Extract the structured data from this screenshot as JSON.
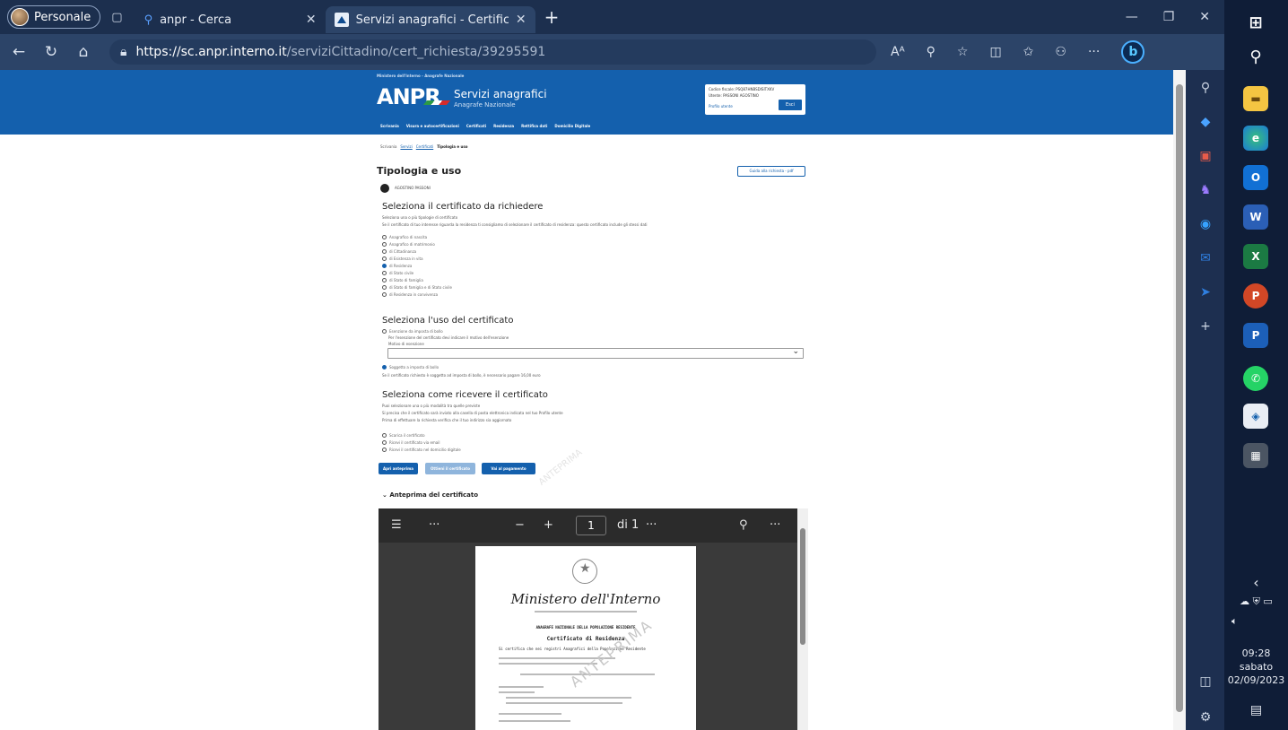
{
  "browser": {
    "profile_label": "Personale",
    "tabs": [
      {
        "title": "anpr - Cerca"
      },
      {
        "title": "Servizi anagrafici - Certificati - "
      }
    ],
    "url_host": "https://sc.anpr.interno.it",
    "url_path": "/serviziCittadino/cert_richiesta/39295591"
  },
  "site": {
    "ministry_line": "Ministero dell'Interno - Anagrafe Nazionale",
    "logo_text": "ANPR",
    "service_title": "Servizi anagrafici",
    "service_subtitle": "Anagrafe Nazionale",
    "user_fiscal_label": "Codice fiscale: PSQ87HNBSDISITXKV",
    "user_name_label": "Utente: PASSONI AGOSTINO",
    "profile_link": "Profilo utente",
    "logout_label": "Esci",
    "nav": [
      "Scrivania",
      "Visura e autocertificazioni",
      "Certificati",
      "Residenza",
      "Rettifica dati",
      "Domicilio Digitale"
    ]
  },
  "breadcrumb": {
    "items": [
      "Scrivania",
      "Servizi",
      "Certificati"
    ],
    "current": "Tipologia e uso"
  },
  "content": {
    "page_title": "Tipologia e uso",
    "guide_button": "Guida alla richiesta - pdf",
    "person_label": "AGOSTINO PASSONI",
    "section1_title": "Seleziona il certificato da richiedere",
    "section1_help_1": "Seleziona una o più tipologie di certificato",
    "section1_help_2": "Se il certificato di tuo interesse riguarda la residenza ti consigliamo di selezionare il certificato di residenza: questo certificato include gli stessi dati",
    "certificates": [
      {
        "label": "Anagrafico di nascita",
        "selected": false
      },
      {
        "label": "Anagrafico di matrimonio",
        "selected": false
      },
      {
        "label": "di Cittadinanza",
        "selected": false
      },
      {
        "label": "di Esistenza in vita",
        "selected": false
      },
      {
        "label": "di Residenza",
        "selected": true
      },
      {
        "label": "di Stato civile",
        "selected": false
      },
      {
        "label": "di Stato di famiglia",
        "selected": false
      },
      {
        "label": "di Stato di famiglia e di Stato civile",
        "selected": false
      },
      {
        "label": "di Residenza in convivenza",
        "selected": false
      }
    ],
    "section2_title": "Seleziona l'uso del certificato",
    "use_options": [
      {
        "label": "Esenzione da imposta di bollo",
        "selected": false
      },
      {
        "label": "Soggetto a imposta di bollo",
        "selected": true
      }
    ],
    "use_help_1": "Per l'esenzione del certificato devi indicare il motivo dell'esenzione",
    "use_help_2": "Motivo di esenzione",
    "use_help_3": "Se il certificato richiesto è soggetto ad imposta di bollo, è necessario pagare 16,00 euro",
    "section3_title": "Seleziona come ricevere il certificato",
    "delivery_help_1": "Puoi selezionare una o più modalità tra quelle previste",
    "delivery_help_2": "Si precisa che il certificato sarà inviato alla casella di posta elettronica indicata nel tuo Profilo utente",
    "delivery_help_3": "Prima di effettuare la richiesta verifica che il tuo indirizzo sia aggiornato",
    "delivery_options": [
      {
        "label": "Scarica il certificato"
      },
      {
        "label": "Ricevi il certificato via email"
      },
      {
        "label": "Ricevi il certificato nel domicilio digitale"
      }
    ],
    "btn_preview": "Apri anteprima",
    "btn_get": "Ottieni il certificato",
    "btn_pay": "Vai al pagamento",
    "preview_toggle": "Anteprima del certificato"
  },
  "pdf_viewer": {
    "page_current": "1",
    "page_total": "di 1",
    "doc_ministry": "Ministero dell'Interno",
    "doc_header": "ANAGRAFE NAZIONALE DELLA POPOLAZIONE RESIDENTE",
    "doc_title": "Certificato di Residenza",
    "doc_section": "Si certifica che nei registri Anagrafici della Popolazione Residente",
    "watermark": "ANTEPRIMA"
  },
  "taskbar": {
    "time": "09:28",
    "day": "sabato",
    "date": "02/09/2023"
  },
  "colors": {
    "brand_blue": "#1460ad",
    "browser_dark": "#1c2f4e",
    "taskbar": "#0f1d37"
  }
}
